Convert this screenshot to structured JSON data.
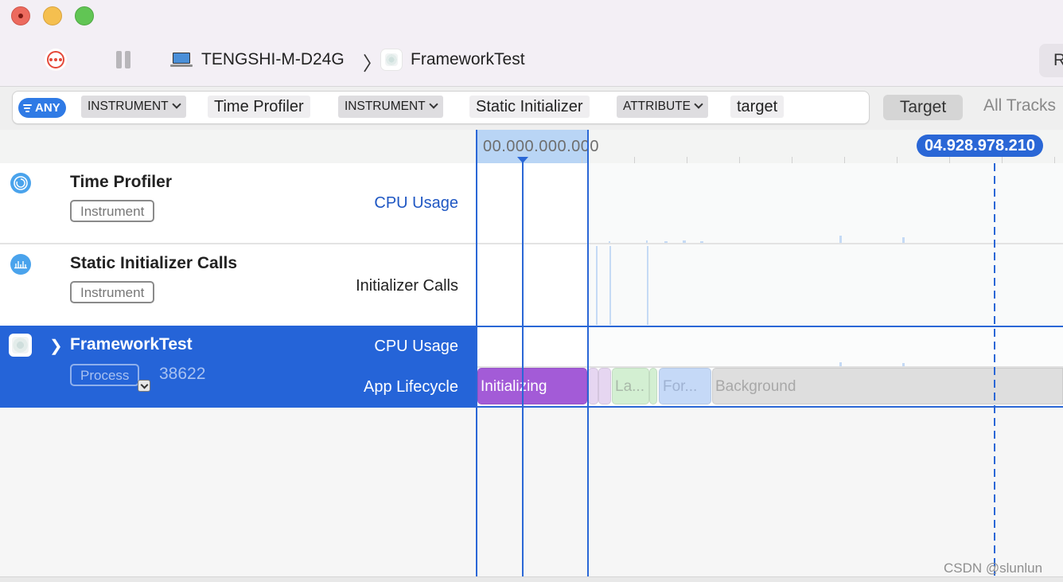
{
  "window": {
    "controls": [
      "close",
      "minimize",
      "maximize"
    ]
  },
  "toolbar": {
    "record_icon": "record-stop-icon",
    "pause_icon": "pause-icon",
    "device_icon": "laptop-icon",
    "device_name": "TENGSHI-M-D24G",
    "breadcrumb_separator": "〉",
    "process_icon": "app-icon",
    "process_name": "FrameworkTest",
    "right_button_label": "R"
  },
  "filter": {
    "any_label": "ANY",
    "tokens": [
      {
        "type": "kind",
        "label": "INSTRUMENT"
      },
      {
        "type": "value",
        "label": "Time Profiler"
      },
      {
        "type": "kind",
        "label": "INSTRUMENT"
      },
      {
        "type": "value",
        "label": "Static Initializer"
      },
      {
        "type": "kind",
        "label": "ATTRIBUTE"
      },
      {
        "type": "value",
        "label": "target"
      }
    ],
    "target_button": "Target",
    "all_tracks_button": "All Tracks"
  },
  "ruler": {
    "start_time": "00.000.000.000",
    "end_time": "04.928.978.210"
  },
  "tracks": [
    {
      "title": "Time Profiler",
      "badge": "Instrument",
      "icon": "time-profiler-icon",
      "label": "CPU Usage",
      "label_color": "#1f57c3"
    },
    {
      "title": "Static Initializer Calls",
      "badge": "Instrument",
      "icon": "bar-chart-icon",
      "label": "Initializer Calls",
      "label_color": "#222222"
    },
    {
      "title": "FrameworkTest",
      "badge": "Process",
      "pid": "38622",
      "icon": "app-icon",
      "labels": [
        "CPU Usage",
        "App Lifecycle"
      ],
      "selected": true
    }
  ],
  "lifecycle": [
    {
      "label": "Initializing",
      "color": "#a35bd7",
      "text_color": "#ffffff"
    },
    {
      "label": "",
      "color": "#e6d6f1",
      "text_color": "#aaaaaa"
    },
    {
      "label": "",
      "color": "#e6d6f1",
      "text_color": "#aaaaaa"
    },
    {
      "label": "La...",
      "color": "#d3efd2",
      "text_color": "#a9b9a9"
    },
    {
      "label": "",
      "color": "#d3efd2",
      "text_color": "#aaaaaa"
    },
    {
      "label": "For...",
      "color": "#c5d9f7",
      "text_color": "#9fb2d2"
    },
    {
      "label": "Background",
      "color": "#dedede",
      "text_color": "#a8a8a8"
    }
  ],
  "colors": {
    "accent": "#2a67d6",
    "selection": "#2564d8",
    "instrument_icon": "#4aa3ec"
  },
  "watermark": "CSDN @slunlun"
}
